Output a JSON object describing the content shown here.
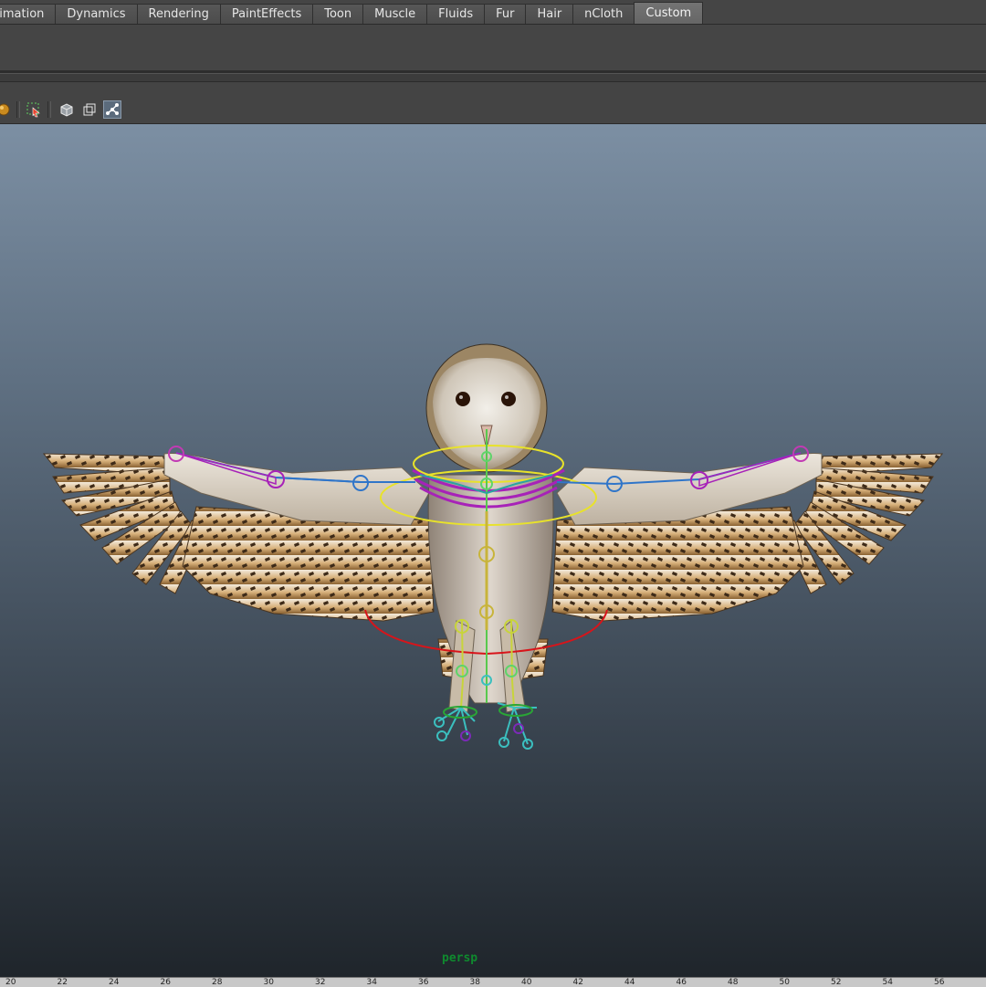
{
  "shelf": {
    "tabs": [
      {
        "label": "nimation",
        "active": false
      },
      {
        "label": "Dynamics",
        "active": false
      },
      {
        "label": "Rendering",
        "active": false
      },
      {
        "label": "PaintEffects",
        "active": false
      },
      {
        "label": "Toon",
        "active": false
      },
      {
        "label": "Muscle",
        "active": false
      },
      {
        "label": "Fluids",
        "active": false
      },
      {
        "label": "Fur",
        "active": false
      },
      {
        "label": "Hair",
        "active": false
      },
      {
        "label": "nCloth",
        "active": false
      },
      {
        "label": "Custom",
        "active": true
      }
    ]
  },
  "viewport_toolbar": {
    "icons": [
      "light-sphere-icon",
      "select-region-icon",
      "wireframe-cube-icon",
      "isolate-frames-icon",
      "joint-xray-icon"
    ]
  },
  "viewport": {
    "camera_label": "persp",
    "colors": {
      "gradient_top": "#7c8fa3",
      "gradient_bottom": "#1f252b",
      "camera_label": "#0f8a2e"
    }
  },
  "timeslider": {
    "ticks": [
      "20",
      "22",
      "24",
      "26",
      "28",
      "30",
      "32",
      "34",
      "36",
      "38",
      "40",
      "42",
      "44",
      "46",
      "48",
      "50",
      "52",
      "54",
      "56"
    ]
  }
}
